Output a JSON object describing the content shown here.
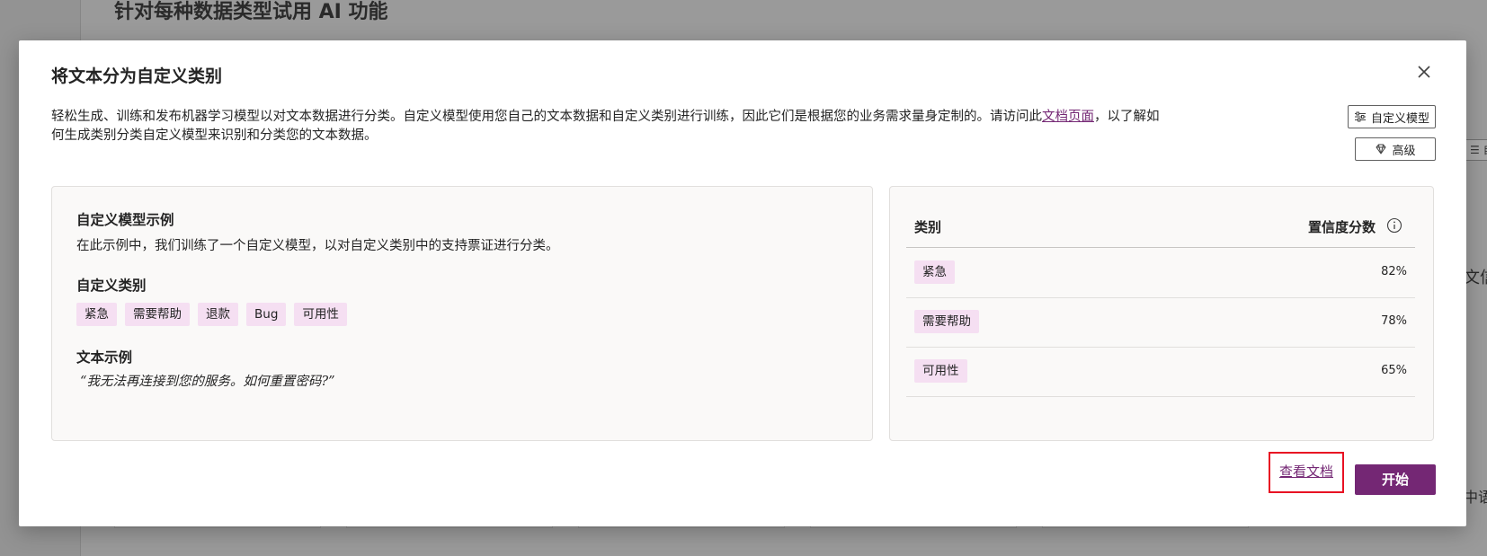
{
  "background": {
    "title": "针对每种数据类型试用 AI 功能",
    "right_button": "☰ 自",
    "right_text_1": "文信",
    "right_text_2": "中语"
  },
  "dialog": {
    "title": "将文本分为自定义类别",
    "description_before_link": "轻松生成、训练和发布机器学习模型以对文本数据进行分类。自定义模型使用您自己的文本数据和自定义类别进行训练，因此它们是根据您的业务需求量身定制的。请访问此",
    "description_link": "文档页面",
    "description_after_link": "，以了解如何生成类别分类自定义模型来识别和分类您的文本数据。",
    "custom_model_button": "自定义模型",
    "premium_button": "高级",
    "example": {
      "heading": "自定义模型示例",
      "subtext": "在此示例中，我们训练了一个自定义模型，以对自定义类别中的支持票证进行分类。",
      "categories_heading": "自定义类别",
      "categories": [
        "紧急",
        "需要帮助",
        "退款",
        "Bug",
        "可用性"
      ],
      "text_example_heading": "文本示例",
      "text_example": "“我无法再连接到您的服务。如何重置密码?”"
    },
    "results": {
      "column_category": "类别",
      "column_score": "置信度分数",
      "rows": [
        {
          "category": "紧急",
          "score": "82%"
        },
        {
          "category": "需要帮助",
          "score": "78%"
        },
        {
          "category": "可用性",
          "score": "65%"
        }
      ]
    },
    "view_docs_link": "查看文档",
    "start_button": "开始"
  },
  "colors": {
    "accent": "#742774",
    "tag_bg": "#f5dff2",
    "highlight_border": "#e81123"
  }
}
